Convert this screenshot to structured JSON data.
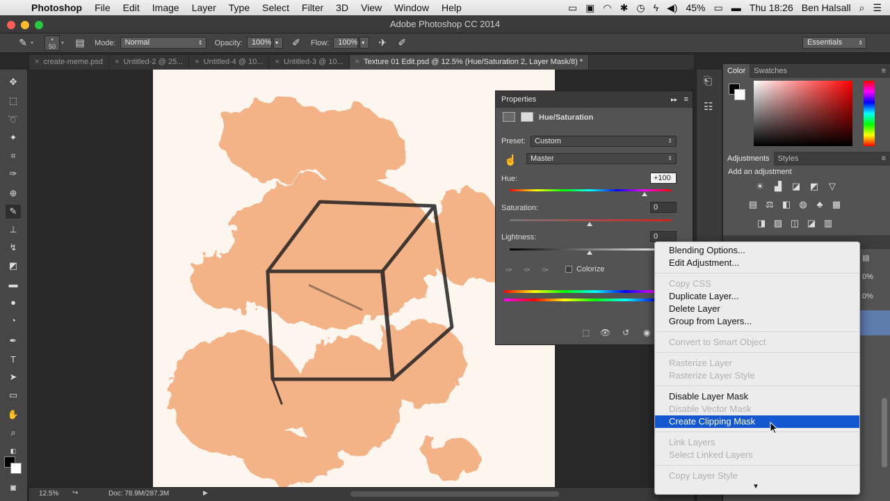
{
  "menubar": {
    "app": "Photoshop",
    "items": [
      "File",
      "Edit",
      "Image",
      "Layer",
      "Type",
      "Select",
      "Filter",
      "3D",
      "View",
      "Window",
      "Help"
    ],
    "battery": "45%",
    "clock": "Thu 18:26",
    "user": "Ben Halsall"
  },
  "window": {
    "title": "Adobe Photoshop CC 2014"
  },
  "options": {
    "brush_size": "50",
    "mode_label": "Mode:",
    "mode_value": "Normal",
    "opacity_label": "Opacity:",
    "opacity_value": "100%",
    "flow_label": "Flow:",
    "flow_value": "100%",
    "workspace": "Essentials"
  },
  "tabs": [
    {
      "label": "create-meme.psd",
      "active": false
    },
    {
      "label": "Untitled-2 @ 25...",
      "active": false
    },
    {
      "label": "Untitled-4 @ 10...",
      "active": false
    },
    {
      "label": "Untitled-3 @ 10...",
      "active": false
    },
    {
      "label": "Texture 01 Edit.psd @ 12.5% (Hue/Saturation 2, Layer Mask/8) *",
      "active": true
    }
  ],
  "status": {
    "zoom": "12.5%",
    "doc": "Doc: 78.9M/287.3M"
  },
  "properties": {
    "title": "Properties",
    "adjustment": "Hue/Saturation",
    "preset_label": "Preset:",
    "preset_value": "Custom",
    "channel_value": "Master",
    "hue_label": "Hue:",
    "hue_value": "+100",
    "saturation_label": "Saturation:",
    "saturation_value": "0",
    "lightness_label": "Lightness:",
    "lightness_value": "0",
    "colorize_label": "Colorize"
  },
  "panels": {
    "color_tabs": [
      "Color",
      "Swatches"
    ],
    "adjust_tabs": [
      "Adjustments",
      "Styles"
    ],
    "add_adjustment": "Add an adjustment",
    "layer_opacity": "0%",
    "layer_fill": "0%"
  },
  "context_menu": {
    "items": [
      {
        "label": "Blending Options...",
        "state": "enabled"
      },
      {
        "label": "Edit Adjustment...",
        "state": "enabled"
      },
      {
        "label": "Copy CSS",
        "state": "disabled"
      },
      {
        "label": "Duplicate Layer...",
        "state": "enabled"
      },
      {
        "label": "Delete Layer",
        "state": "enabled"
      },
      {
        "label": "Group from Layers...",
        "state": "enabled"
      },
      {
        "label": "Convert to Smart Object",
        "state": "disabled"
      },
      {
        "label": "Rasterize Layer",
        "state": "disabled"
      },
      {
        "label": "Rasterize Layer Style",
        "state": "disabled"
      },
      {
        "label": "Disable Layer Mask",
        "state": "enabled"
      },
      {
        "label": "Disable Vector Mask",
        "state": "disabled"
      },
      {
        "label": "Create Clipping Mask",
        "state": "selected"
      },
      {
        "label": "Link Layers",
        "state": "disabled"
      },
      {
        "label": "Select Linked Layers",
        "state": "disabled"
      },
      {
        "label": "Copy Layer Style",
        "state": "disabled"
      }
    ],
    "more_arrow": "▼"
  },
  "colors": {
    "accent": "#1358d0",
    "texture": "#f0a06a"
  }
}
